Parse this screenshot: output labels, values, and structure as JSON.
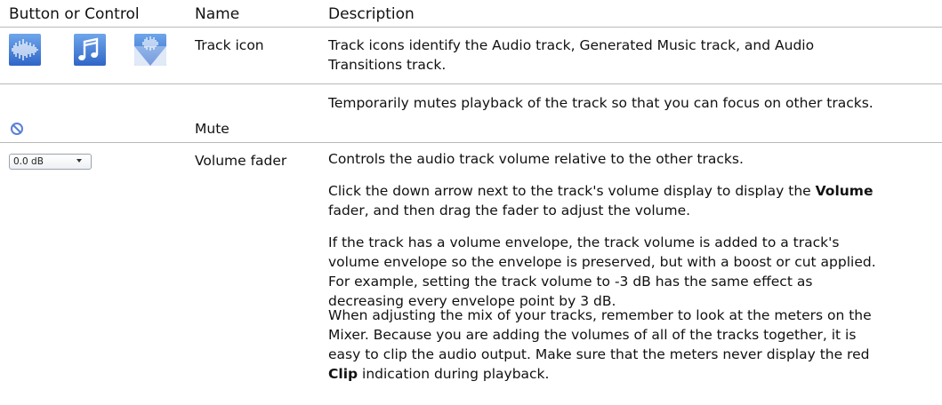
{
  "header": {
    "col_control": "Button or Control",
    "col_name": "Name",
    "col_description": "Description"
  },
  "rows": [
    {
      "icons": [
        "audio-track-icon",
        "music-track-icon",
        "audio-transitions-track-icon"
      ],
      "name": "Track icon",
      "description": [
        "Track icons identify the Audio track, Generated Music track, and Audio",
        "Transitions track."
      ]
    },
    {
      "icon": "mute-icon",
      "name": "Mute",
      "description": [
        "Temporarily mutes playback of the track so that you can focus on other tracks."
      ]
    },
    {
      "control": {
        "value": "0.0 dB",
        "icon": "dropdown-arrow-icon"
      },
      "name": "Volume fader",
      "paragraphs": [
        {
          "lines": [
            "Controls the audio track volume relative to the other tracks."
          ]
        },
        {
          "line1_pre": "Click the down arrow next to the track's volume display to display the ",
          "line1_bold": "Volume",
          "line2": "fader, and then drag the fader to adjust the volume."
        },
        {
          "lines": [
            "If the track has a volume envelope, the track volume is added to a track's",
            "volume envelope so the envelope is preserved, but with a boost or cut applied.",
            "For example, setting the track volume to -3 dB has the same effect as",
            "decreasing every envelope point by 3 dB."
          ]
        },
        {
          "lines": [
            "When adjusting the mix of your tracks, remember to look at the meters on the",
            "Mixer. Because you are adding the volumes of all of the tracks together, it is",
            "easy to clip the audio output. Make sure that the meters never display the red"
          ],
          "last_bold": "Clip",
          "last_post": " indication during playback."
        }
      ]
    }
  ],
  "colors": {
    "rule": "#b9b9b9",
    "icon_blue": "#2f66c8",
    "mute_blue": "#5a7fd6"
  }
}
